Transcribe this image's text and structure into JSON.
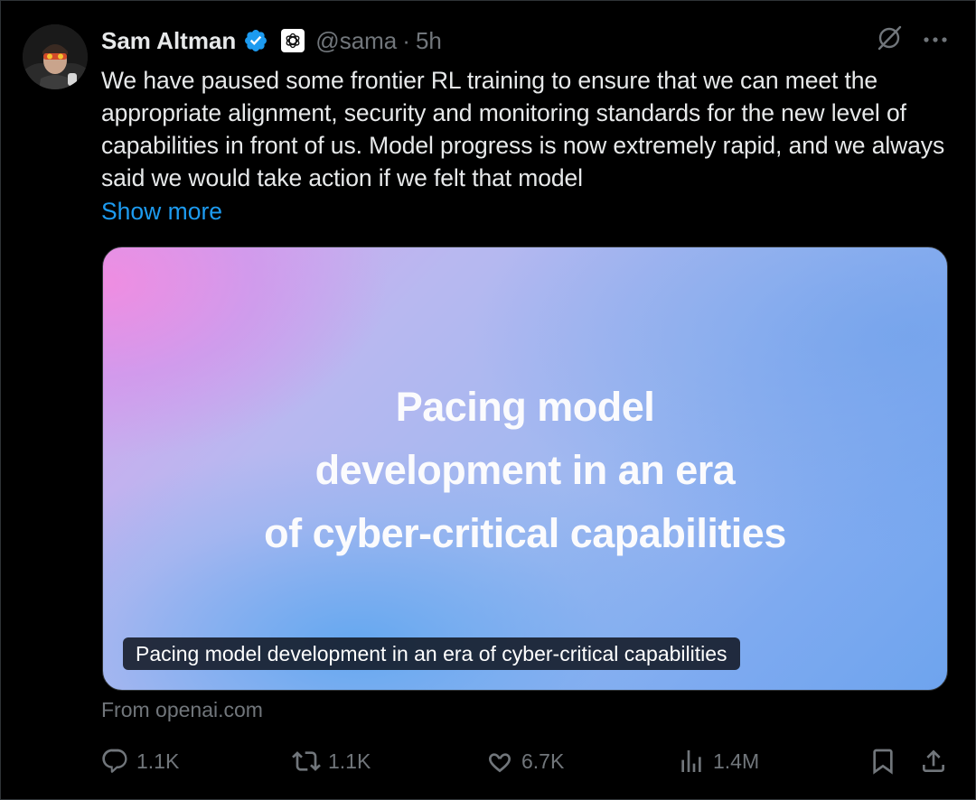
{
  "author": {
    "name": "Sam Altman",
    "handle": "@sama",
    "separator": "·",
    "time": "5h"
  },
  "tweet": {
    "text": "We have paused some frontier RL training to ensure that we can meet the appropriate alignment, security and monitoring standards for the new level of capabilities in front of us. Model progress is now extremely rapid, and we always said we would take action if we felt that model",
    "show_more": "Show more"
  },
  "card": {
    "title_lines": [
      "Pacing model",
      "development in an era",
      "of cyber-critical capabilities"
    ],
    "caption": "Pacing model development in an era of cyber-critical capabilities",
    "source": "From openai.com"
  },
  "actions": {
    "replies": "1.1K",
    "reposts": "1.1K",
    "likes": "6.7K",
    "views": "1.4M"
  },
  "icons": {
    "verified": "verified-badge-icon",
    "affiliate": "openai-logo-icon",
    "grok": "grok-icon",
    "more": "more-icon",
    "reply": "reply-icon",
    "repost": "repost-icon",
    "like": "like-icon",
    "views": "views-icon",
    "bookmark": "bookmark-icon",
    "share": "share-icon"
  },
  "colors": {
    "link": "#1d9bf0",
    "muted": "#71767b",
    "text": "#e7e9ea",
    "verified": "#1d9bf0"
  }
}
